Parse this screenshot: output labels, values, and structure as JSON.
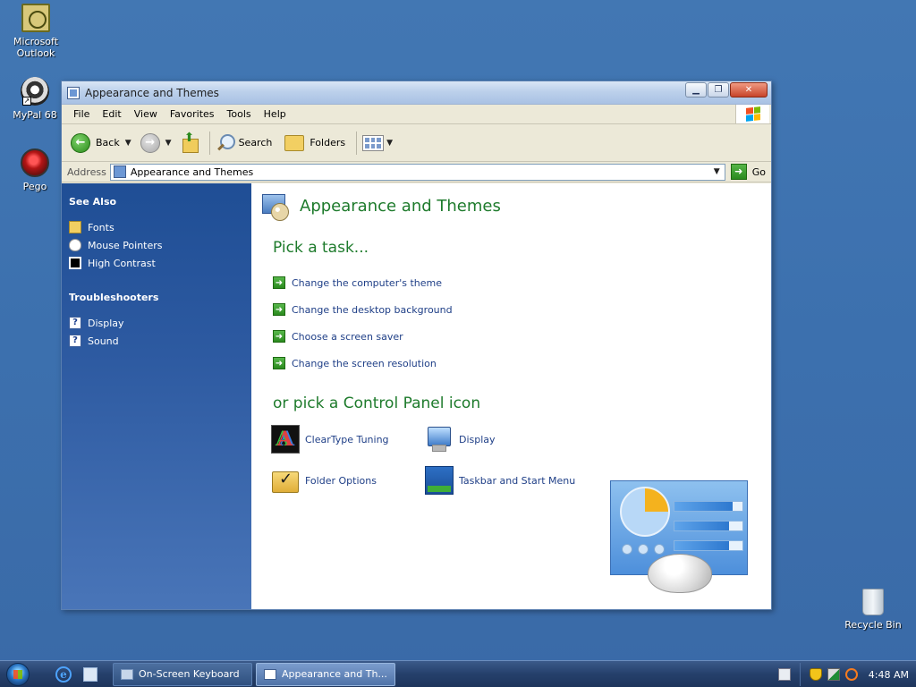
{
  "desktop": {
    "icons": [
      {
        "label": "Microsoft Outlook",
        "icon": "outlook-icon"
      },
      {
        "label": "MyPal 68",
        "icon": "mypal-icon"
      },
      {
        "label": "Pego",
        "icon": "pego-icon"
      },
      {
        "label": "Recycle Bin",
        "icon": "recycle-bin-icon"
      }
    ]
  },
  "window": {
    "title": "Appearance and Themes",
    "controls": {
      "minimize": "▁",
      "maximize": "❐",
      "close": "✕"
    },
    "menu": [
      "File",
      "Edit",
      "View",
      "Favorites",
      "Tools",
      "Help"
    ],
    "toolbar": {
      "back": "Back",
      "search": "Search",
      "folders": "Folders"
    },
    "address": {
      "label": "Address",
      "value": "Appearance and Themes",
      "go": "Go"
    },
    "sidebar": {
      "see_also_title": "See Also",
      "see_also": [
        {
          "label": "Fonts",
          "icon": "fonts-folder-icon"
        },
        {
          "label": "Mouse Pointers",
          "icon": "mouse-icon"
        },
        {
          "label": "High Contrast",
          "icon": "high-contrast-icon"
        }
      ],
      "troubleshooters_title": "Troubleshooters",
      "troubleshooters": [
        {
          "label": "Display",
          "icon": "help-icon"
        },
        {
          "label": "Sound",
          "icon": "help-icon"
        }
      ]
    },
    "main": {
      "title": "Appearance and Themes",
      "pick_task": "Pick a task...",
      "tasks": [
        "Change the computer's theme",
        "Change the desktop background",
        "Choose a screen saver",
        "Change the screen resolution"
      ],
      "or_pick_icon": "or pick a Control Panel icon",
      "icons": [
        {
          "label": "ClearType Tuning",
          "icon": "cleartype-icon"
        },
        {
          "label": "Display",
          "icon": "display-icon"
        },
        {
          "label": "Folder Options",
          "icon": "folder-options-icon"
        },
        {
          "label": "Taskbar and Start Menu",
          "icon": "taskbar-icon"
        }
      ],
      "illustration": {
        "pie_fraction": 0.25,
        "bars": [
          0.85,
          0.8,
          0.8
        ]
      }
    }
  },
  "taskbar": {
    "tasks": [
      {
        "label": "On-Screen Keyboard",
        "active": false
      },
      {
        "label": "Appearance and Th...",
        "active": true
      }
    ],
    "clock": "4:48 AM"
  },
  "colors": {
    "desktop": "#3c70ae",
    "sidebar": "#2d5aa1",
    "heading_green": "#1e7b2c",
    "link_blue": "#1f3f87"
  }
}
